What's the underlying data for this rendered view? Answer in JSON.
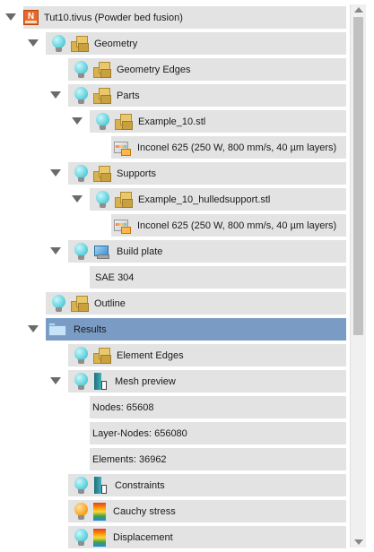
{
  "tree": {
    "root": "Tut10.tivus (Powder bed fusion)",
    "geometry": "Geometry",
    "geometry_edges": "Geometry Edges",
    "parts": "Parts",
    "example_stl": "Example_10.stl",
    "material_1": "Inconel 625 (250 W, 800 mm/s, 40 µm layers)",
    "supports": "Supports",
    "support_stl": "Example_10_hulledsupport.stl",
    "material_2": "Inconel 625 (250 W, 800 mm/s, 40 µm layers)",
    "build_plate": "Build plate",
    "plate_material": "SAE 304",
    "outline": "Outline",
    "results": "Results",
    "element_edges": "Element Edges",
    "mesh_preview": "Mesh preview",
    "nodes": "Nodes: 65608",
    "layer_nodes": "Layer-Nodes: 656080",
    "elements": "Elements: 36962",
    "constraints": "Constraints",
    "cauchy_stress": "Cauchy stress",
    "displacement": "Displacement"
  },
  "icons": {
    "app": "tivus-app-icon",
    "visibility": "lightbulb-icon",
    "group": "geometry-folder-icon",
    "material": "material-icon",
    "plate": "build-plate-icon",
    "mesh": "mesh-icon",
    "field": "colorbar-icon",
    "results": "folder-icon"
  },
  "colors": {
    "row_bg": "#e3e3e3",
    "selected_bg": "#7a9cc4",
    "bulb_on": "#62d3de",
    "bulb_active": "#f9a825"
  }
}
